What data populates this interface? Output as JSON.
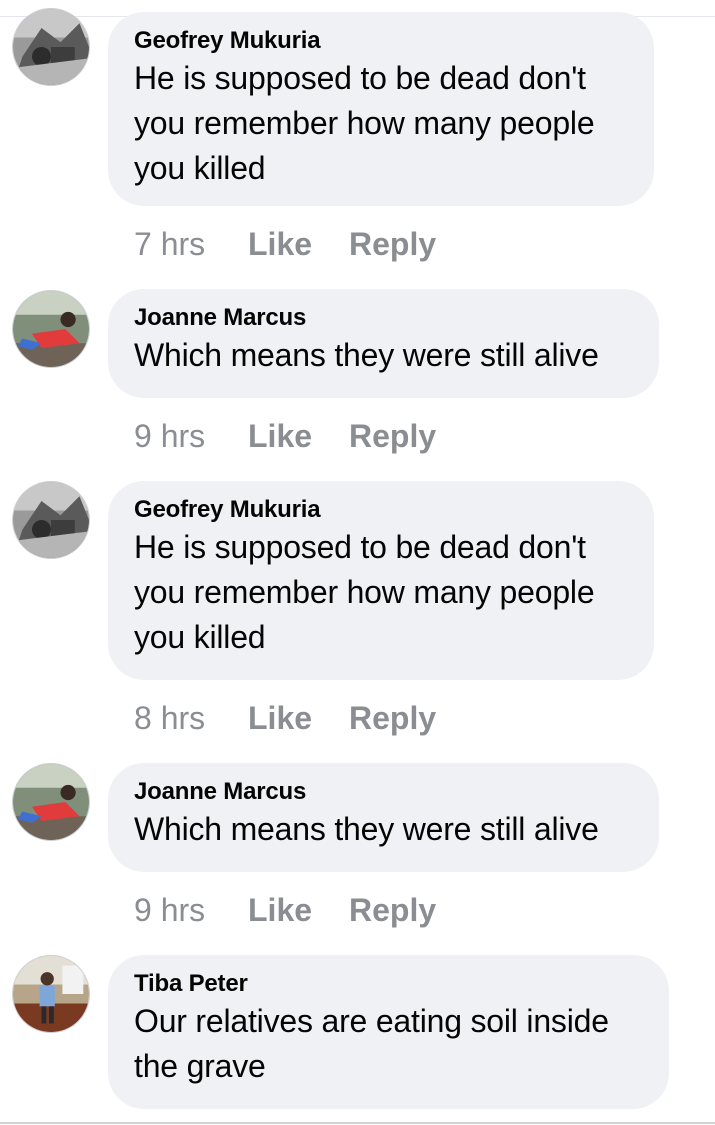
{
  "comments": [
    {
      "author": "Geofrey Mukuria",
      "lines": [
        "He is supposed to be dead don't",
        "you remember how many people",
        "you killed"
      ],
      "time": "7 hrs",
      "like": "Like",
      "reply": "Reply",
      "avatar": "machinery-photo"
    },
    {
      "author": "Joanne Marcus",
      "lines": [
        "Which means they were still alive"
      ],
      "time": "9 hrs",
      "like": "Like",
      "reply": "Reply",
      "avatar": "woman-red-top-photo"
    },
    {
      "author": "Geofrey Mukuria",
      "lines": [
        "He is supposed to be dead don't",
        "you remember how many people",
        "you killed"
      ],
      "time": "8 hrs",
      "like": "Like",
      "reply": "Reply",
      "avatar": "machinery-photo"
    },
    {
      "author": "Joanne Marcus",
      "lines": [
        "Which means they were still alive"
      ],
      "time": "9 hrs",
      "like": "Like",
      "reply": "Reply",
      "avatar": "woman-red-top-photo"
    },
    {
      "author": "Tiba Peter",
      "lines": [
        "Our relatives are eating soil inside",
        "the grave"
      ],
      "avatar": "man-office-photo"
    }
  ]
}
